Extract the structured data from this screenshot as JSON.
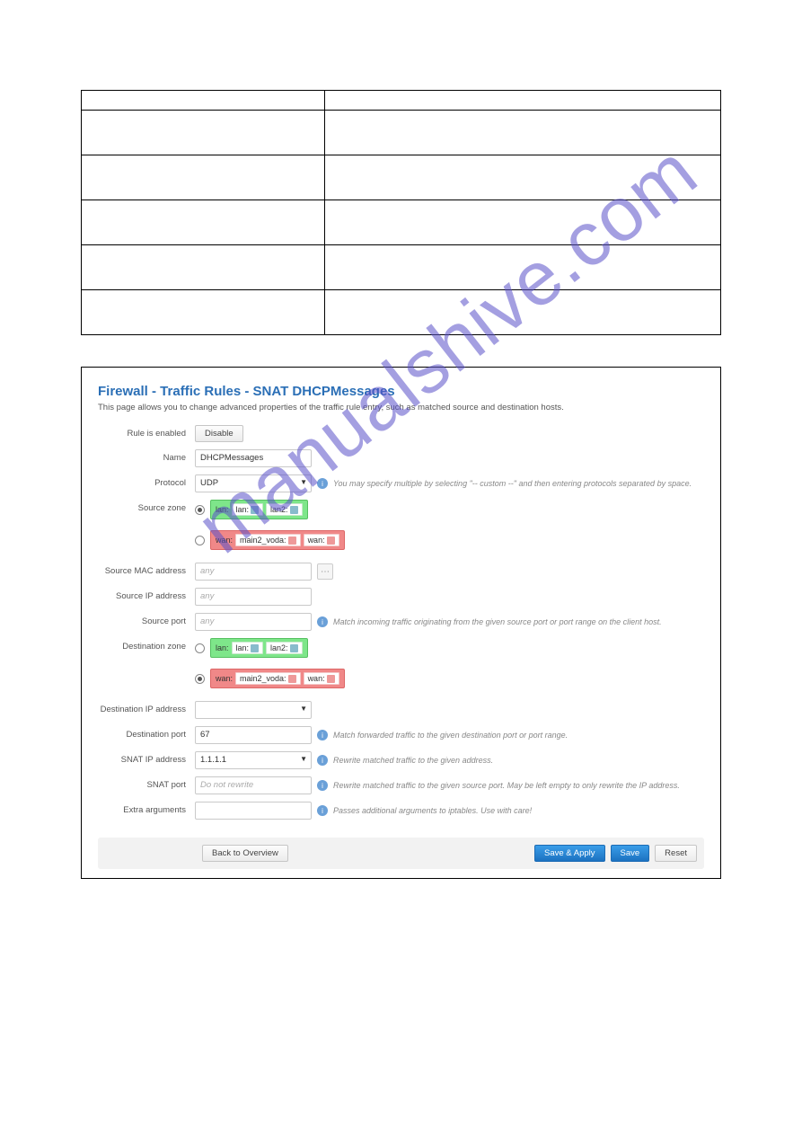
{
  "page": {
    "title": "Firewall - Traffic Rules - SNAT DHCPMessages",
    "description": "This page allows you to change advanced properties of the traffic rule entry, such as matched source and destination hosts."
  },
  "labels": {
    "rule_enabled": "Rule is enabled",
    "name": "Name",
    "protocol": "Protocol",
    "source_zone": "Source zone",
    "source_mac": "Source MAC address",
    "source_ip": "Source IP address",
    "source_port": "Source port",
    "dest_zone": "Destination zone",
    "dest_ip": "Destination IP address",
    "dest_port": "Destination port",
    "snat_ip": "SNAT IP address",
    "snat_port": "SNAT port",
    "extra": "Extra arguments"
  },
  "values": {
    "disable_btn": "Disable",
    "name": "DHCPMessages",
    "protocol": "UDP",
    "dest_port": "67",
    "snat_ip": "1.1.1.1",
    "snat_port_ph": "Do not rewrite",
    "any_ph": "any"
  },
  "zones": {
    "lan_label": "lan:",
    "lan_if1": "lan:",
    "lan_if2": "lan2:",
    "wan_label": "wan:",
    "wan_if1": "main2_voda:",
    "wan_if2": "wan:"
  },
  "help": {
    "protocol": "You may specify multiple by selecting \"-- custom --\" and then entering protocols separated by space.",
    "source_port": "Match incoming traffic originating from the given source port or port range on the client host.",
    "dest_port": "Match forwarded traffic to the given destination port or port range.",
    "snat_ip": "Rewrite matched traffic to the given address.",
    "snat_port": "Rewrite matched traffic to the given source port. May be left empty to only rewrite the IP address.",
    "extra": "Passes additional arguments to iptables. Use with care!"
  },
  "buttons": {
    "back": "Back to Overview",
    "save_apply": "Save & Apply",
    "save": "Save",
    "reset": "Reset"
  },
  "watermark": "manualshive.com"
}
